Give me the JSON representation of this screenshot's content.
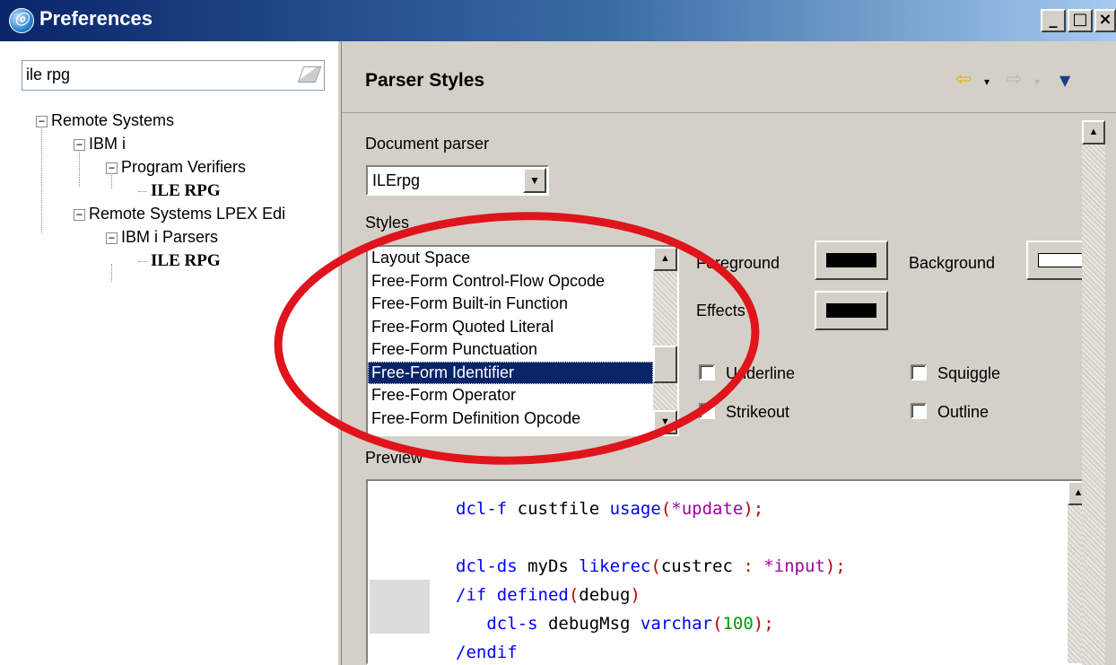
{
  "window": {
    "title": "Preferences",
    "icon": "eclipse-icon",
    "controls": [
      "minimize",
      "maximize",
      "close"
    ]
  },
  "filter": {
    "value": "ile rpg"
  },
  "tree": [
    {
      "label": "Remote Systems",
      "level": 0,
      "expanded": true,
      "leaf": false
    },
    {
      "label": "IBM i",
      "level": 1,
      "expanded": true,
      "leaf": false
    },
    {
      "label": "Program Verifiers",
      "level": 2,
      "expanded": true,
      "leaf": false
    },
    {
      "label": "ILE RPG",
      "level": 3,
      "leaf": true
    },
    {
      "label": "Remote Systems LPEX Edi",
      "level": 1,
      "expanded": true,
      "leaf": false
    },
    {
      "label": "IBM i Parsers",
      "level": 2,
      "expanded": true,
      "leaf": false
    },
    {
      "label": "ILE RPG",
      "level": 3,
      "leaf": true
    }
  ],
  "page": {
    "title": "Parser Styles",
    "nav": {
      "back": "⇦",
      "forward": "⇨",
      "menu": "▼",
      "dropdown": "▾"
    },
    "document_parser": {
      "label": "Document parser",
      "value": "ILErpg"
    },
    "styles": {
      "label": "Styles",
      "items": [
        "Layout Space",
        "Free-Form Control-Flow Opcode",
        "Free-Form Built-in Function",
        "Free-Form Quoted Literal",
        "Free-Form Punctuation",
        "Free-Form Identifier",
        "Free-Form Operator",
        "Free-Form Definition Opcode"
      ],
      "selected_index": 5
    },
    "foreground": {
      "label": "Foreground",
      "color": "#000000"
    },
    "background": {
      "label": "Background",
      "color": "#ffffff"
    },
    "effects": {
      "label": "Effects",
      "color": "#000000"
    },
    "checkboxes": {
      "underline": {
        "label": "Underline",
        "checked": false
      },
      "squiggle": {
        "label": "Squiggle",
        "checked": false
      },
      "strikeout": {
        "label": "Strikeout",
        "checked": false
      },
      "outline": {
        "label": "Outline",
        "checked": false
      }
    },
    "preview": {
      "label": "Preview",
      "lines": [
        [
          [
            "kw",
            "dcl-f"
          ],
          [
            "id",
            " custfile "
          ],
          [
            "fn",
            "usage"
          ],
          [
            "op",
            "("
          ],
          [
            "str",
            "*update"
          ],
          [
            "op",
            ");"
          ]
        ],
        [],
        [
          [
            "kw",
            "dcl-ds"
          ],
          [
            "id",
            " myDs "
          ],
          [
            "fn",
            "likerec"
          ],
          [
            "op",
            "("
          ],
          [
            "id",
            "custrec "
          ],
          [
            "op",
            ":"
          ],
          [
            "str",
            " *input"
          ],
          [
            "op",
            ");"
          ]
        ],
        [
          [
            "kw",
            "/if"
          ],
          [
            "fn",
            " defined"
          ],
          [
            "op",
            "("
          ],
          [
            "id",
            "debug"
          ],
          [
            "op",
            ")"
          ]
        ],
        [
          [
            "id",
            "   "
          ],
          [
            "kw",
            "dcl-s"
          ],
          [
            "id",
            " debugMsg "
          ],
          [
            "fn",
            "varchar"
          ],
          [
            "op",
            "("
          ],
          [
            "num",
            "100"
          ],
          [
            "op",
            ");"
          ]
        ],
        [
          [
            "kw",
            "/endif"
          ]
        ]
      ]
    }
  },
  "colors": {
    "selection": "#0a246a",
    "annotation_ring": "#e0141c"
  }
}
